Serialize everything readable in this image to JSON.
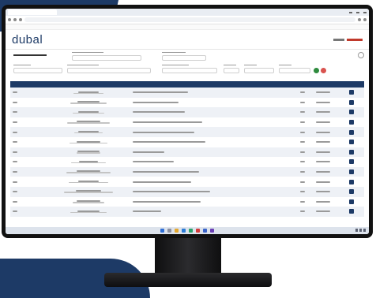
{
  "app": {
    "logo_text": "dubal",
    "user_name": "",
    "page_title": ""
  },
  "filters": {
    "fields": [],
    "buttons": [
      "search",
      "reset"
    ]
  },
  "table": {
    "headers": [],
    "rows": [
      {
        "cells": [
          "",
          "",
          "",
          "",
          ""
        ]
      },
      {
        "cells": [
          "",
          "",
          "",
          "",
          ""
        ]
      },
      {
        "cells": [
          "",
          "",
          "",
          "",
          ""
        ]
      },
      {
        "cells": [
          "",
          "",
          "",
          "",
          ""
        ]
      },
      {
        "cells": [
          "",
          "",
          "",
          "",
          ""
        ]
      },
      {
        "cells": [
          "",
          "",
          "",
          "",
          ""
        ]
      },
      {
        "cells": [
          "",
          "",
          "",
          "",
          ""
        ]
      },
      {
        "cells": [
          "",
          "",
          "",
          "",
          ""
        ]
      },
      {
        "cells": [
          "",
          "",
          "",
          "",
          ""
        ]
      },
      {
        "cells": [
          "",
          "",
          "",
          "",
          ""
        ]
      },
      {
        "cells": [
          "",
          "",
          "",
          "",
          ""
        ]
      },
      {
        "cells": [
          "",
          "",
          "",
          "",
          ""
        ]
      },
      {
        "cells": [
          "",
          "",
          "",
          "",
          ""
        ]
      }
    ]
  },
  "colors": {
    "brand": "#1d3a66",
    "accent_red": "#c0392b",
    "search_button": "#2e8b3e",
    "reset_button": "#d9534f"
  }
}
